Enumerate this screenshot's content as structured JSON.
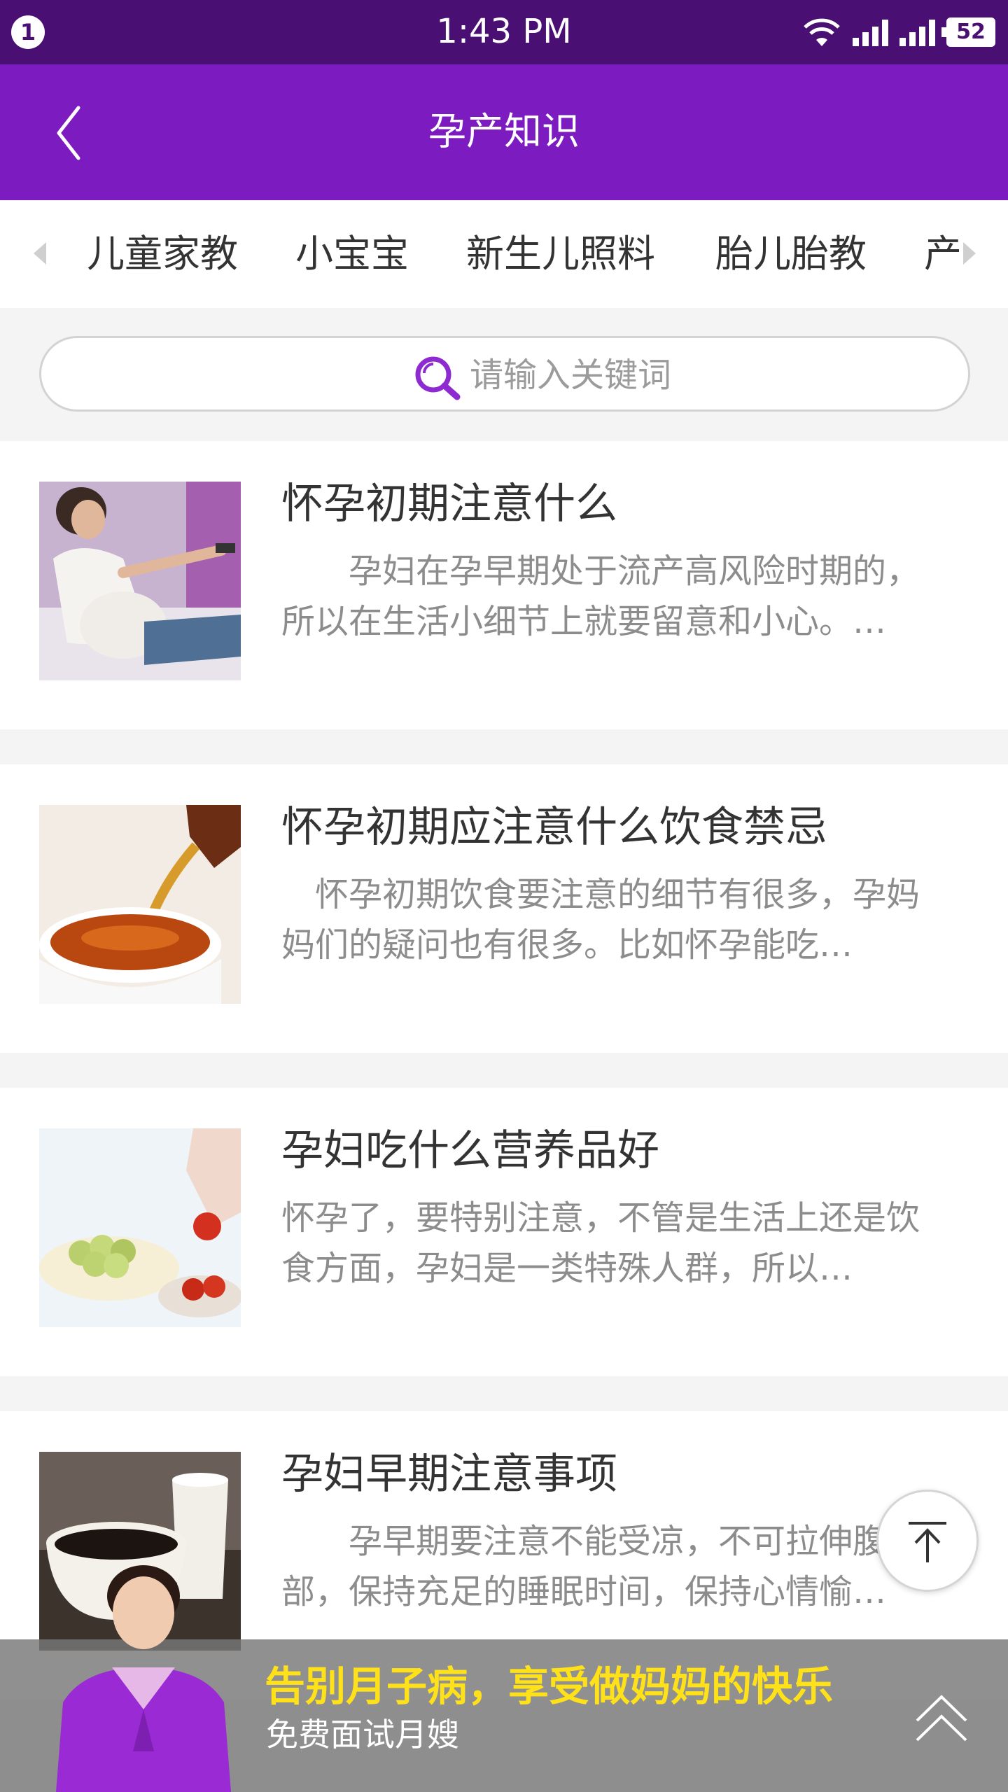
{
  "status_bar": {
    "notification_count": "1",
    "time": "1:43 PM",
    "battery": "52",
    "icons": [
      "wifi-icon",
      "signal-icon",
      "signal-icon",
      "battery-icon"
    ]
  },
  "header": {
    "title": "孕产知识",
    "back_icon": "chevron-left-icon"
  },
  "tabs": {
    "items": [
      "儿童家教",
      "小宝宝",
      "新生儿照料",
      "胎儿胎教",
      "产"
    ]
  },
  "search": {
    "placeholder": "请输入关键词",
    "icon": "search-icon"
  },
  "articles": [
    {
      "title": "怀孕初期注意什么",
      "desc": "　　孕妇在孕早期处于流产高风险时期的，所以在生活小细节上就要留意和小心。…",
      "image": "pregnant-woman-photo"
    },
    {
      "title": "怀孕初期应注意什么饮食禁忌",
      "desc": "　怀孕初期饮食要注意的细节有很多，孕妈妈们的疑问也有很多。比如怀孕能吃…",
      "image": "tea-pouring-photo"
    },
    {
      "title": "孕妇吃什么营养品好",
      "desc": "怀孕了，要特别注意，不管是生活上还是饮食方面，孕妇是一类特殊人群，所以…",
      "image": "fruit-bowl-photo"
    },
    {
      "title": "孕妇早期注意事项",
      "desc": "　　孕早期要注意不能受凉，不可拉伸腹部，保持充足的睡眠时间，保持心情愉…",
      "image": "coffee-cup-photo"
    }
  ],
  "banner": {
    "headline": "告别月子病，享受做妈妈的快乐",
    "subtext": "免费面试月嫂",
    "headline_color": "#ffe11a"
  },
  "colors": {
    "status_bar": "#4a0f73",
    "header": "#7c1bbf",
    "accent": "#8e2bd0"
  }
}
